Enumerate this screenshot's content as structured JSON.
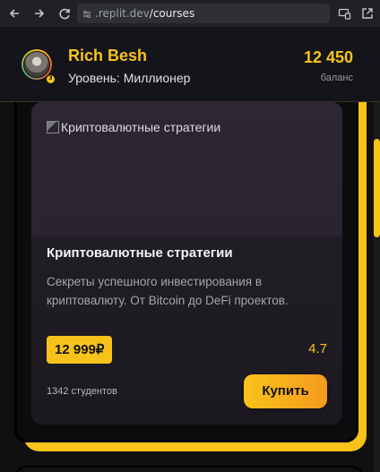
{
  "browser": {
    "url_host": ".replit.dev",
    "url_path": "/courses",
    "back_icon": "arrow-left-icon",
    "forward_icon": "arrow-right-icon",
    "reload_icon": "reload-icon"
  },
  "header": {
    "user_name": "Rich Besh",
    "user_level": "Уровень: Миллионер",
    "level_badge": "3",
    "balance_value": "12 450",
    "balance_label": "баланс"
  },
  "course": {
    "image_alt": "Криптовалютные стратегии",
    "title": "Криптовалютные стратегии",
    "description": "Секреты успешного инвестирования в криптовалюту. От Bitcoin до DeFi проектов.",
    "price": "12 999₽",
    "rating": "4.7",
    "students": "1342 студентов",
    "buy_label": "Купить"
  },
  "colors": {
    "accent": "#f7c31a",
    "background": "#101010",
    "card": "#252129"
  }
}
